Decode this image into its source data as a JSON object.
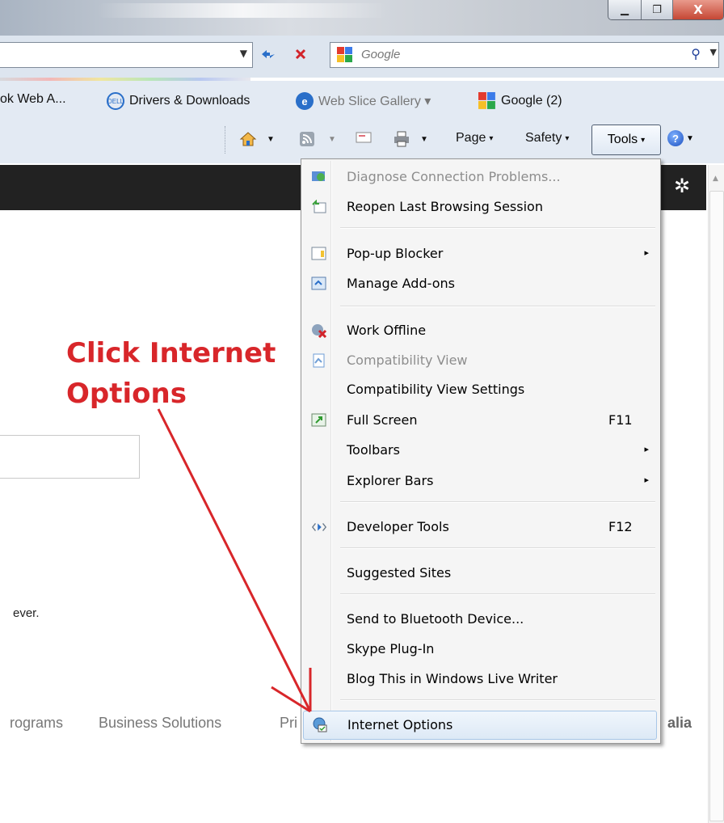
{
  "titlebar": {
    "minimize": "▁",
    "maximize": "❐",
    "close": "X"
  },
  "address": {
    "refresh_icon": "refresh-icon",
    "stop_icon": "stop-icon"
  },
  "search": {
    "placeholder": "Google"
  },
  "favorites": [
    {
      "label": "ok Web A...",
      "icon": "none"
    },
    {
      "label": "Drivers & Downloads",
      "icon": "dell-icon"
    },
    {
      "label": "Web Slice Gallery ▾",
      "icon": "ie-icon"
    },
    {
      "label": "Google (2)",
      "icon": "google-icon"
    }
  ],
  "commandbar": {
    "page": "Page",
    "safety": "Safety",
    "tools": "Tools",
    "caret": "▾"
  },
  "tools_menu": {
    "items": [
      {
        "label": "Diagnose Connection Problems...",
        "disabled": true
      },
      {
        "label": "Reopen Last Browsing Session",
        "disabled": false
      },
      {
        "label": "Pop-up Blocker",
        "disabled": false,
        "submenu": true
      },
      {
        "label": "Manage Add-ons",
        "disabled": false
      },
      {
        "label": "Work Offline",
        "disabled": false
      },
      {
        "label": "Compatibility View",
        "disabled": true
      },
      {
        "label": "Compatibility View Settings",
        "disabled": false
      },
      {
        "label": "Full Screen",
        "disabled": false,
        "shortcut": "F11"
      },
      {
        "label": "Toolbars",
        "disabled": false,
        "submenu": true
      },
      {
        "label": "Explorer Bars",
        "disabled": false,
        "submenu": true
      },
      {
        "label": "Developer Tools",
        "disabled": false,
        "shortcut": "F12"
      },
      {
        "label": "Suggested Sites",
        "disabled": false
      },
      {
        "label": "Send to Bluetooth Device...",
        "disabled": false
      },
      {
        "label": "Skype Plug-In",
        "disabled": false
      },
      {
        "label": "Blog This in Windows Live Writer",
        "disabled": false
      },
      {
        "label": "Internet Options",
        "disabled": false,
        "highlighted": true
      }
    ],
    "submenu_glyph": "▸"
  },
  "page": {
    "ever_text": "ever.",
    "footer_programs": "rograms",
    "footer_business": "Business Solutions",
    "footer_pri": "Pri",
    "footer_right": "alia"
  },
  "annotation": {
    "line1": "Click Internet",
    "line2": "Options",
    "color": "#d8262a"
  }
}
